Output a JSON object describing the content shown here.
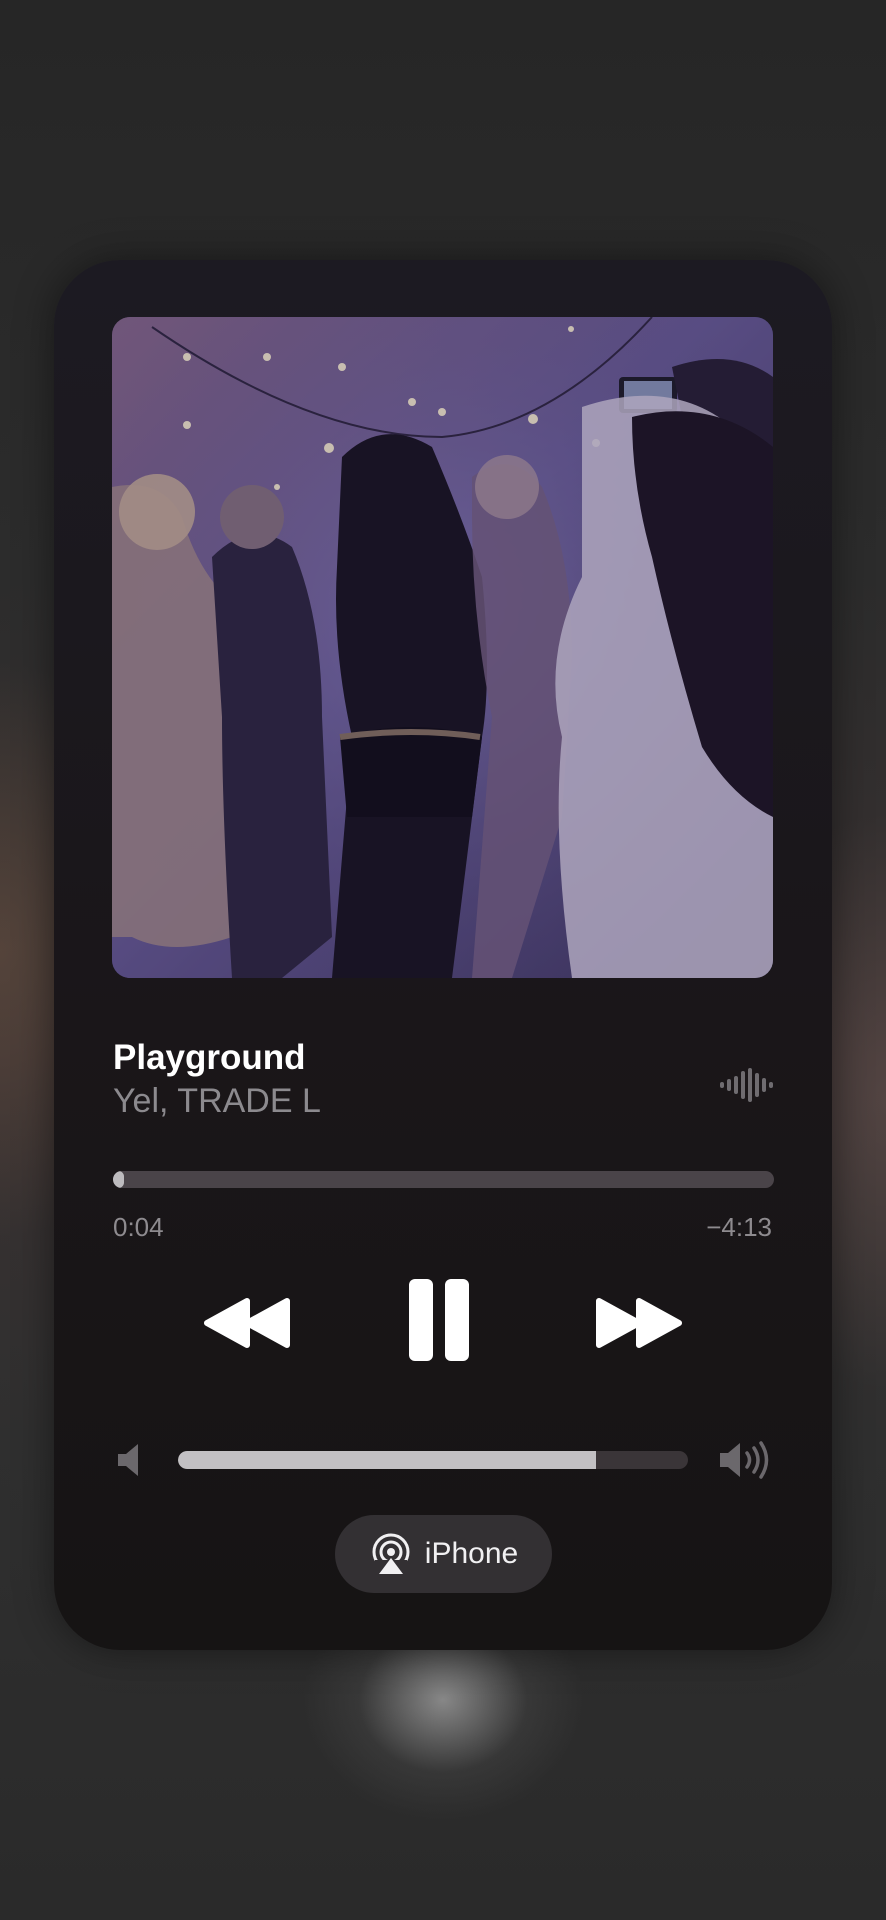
{
  "now_playing": {
    "title": "Playground",
    "artist": "Yel, TRADE L",
    "artwork_icon": "album-artwork-crowd-photo",
    "indicator_icon": "waveform-icon"
  },
  "progress": {
    "elapsed": "0:04",
    "remaining": "−4:13",
    "fraction": 0.016
  },
  "controls": {
    "rewind_icon": "rewind-icon",
    "pause_icon": "pause-icon",
    "forward_icon": "fast-forward-icon"
  },
  "volume": {
    "level": 0.82,
    "low_icon": "speaker-low-icon",
    "high_icon": "speaker-high-icon"
  },
  "output": {
    "device_label": "iPhone",
    "icon": "airplay-icon"
  },
  "colors": {
    "card_background": "#1c1a22",
    "title": "#ffffff",
    "secondary_text": "#8c8a8e",
    "accent_fill": "#c2c0c3"
  }
}
